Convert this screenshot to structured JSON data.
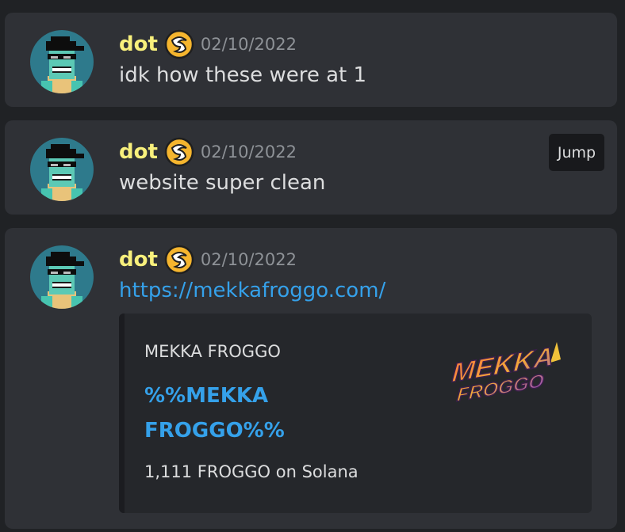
{
  "messages": [
    {
      "username": "dot",
      "timestamp": "02/10/2022",
      "text": "idk how these were at 1"
    },
    {
      "username": "dot",
      "timestamp": "02/10/2022",
      "text": "website super clean",
      "jump_label": "Jump"
    },
    {
      "username": "dot",
      "timestamp": "02/10/2022",
      "link": "https://mekkafroggo.com/",
      "embed": {
        "provider": "MEKKA FROGGO",
        "title": "%%MEKKA FROGGO%%",
        "description": "1,111 FROGGO on Solana",
        "thumbnail_text": "MEKKA FROGGO"
      }
    }
  ],
  "colors": {
    "username": "#f8f07c",
    "link": "#35a1ea",
    "card_background": "#2f3136",
    "page_background": "#202225"
  },
  "icons": {
    "avatar": "pixel-frog-avatar",
    "badge": "orange-swirl-badge-icon"
  }
}
